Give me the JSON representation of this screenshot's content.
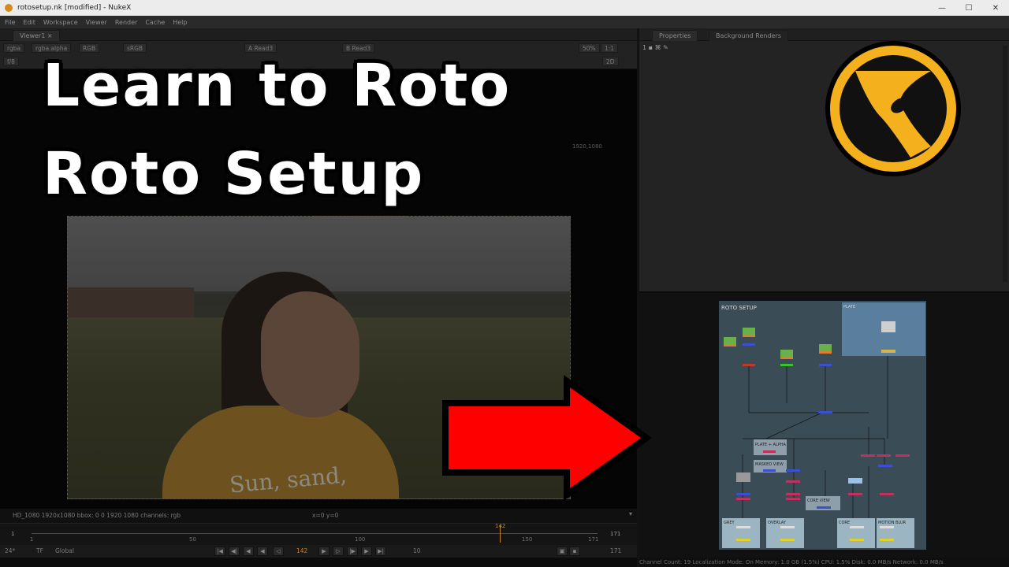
{
  "window": {
    "title": "rotosetup.nk [modified] - NukeX",
    "minimize": "—",
    "maximize": "☐",
    "close": "✕"
  },
  "menu": [
    "File",
    "Edit",
    "Workspace",
    "Viewer",
    "Render",
    "Cache",
    "Help"
  ],
  "viewer": {
    "tab": "Viewer1",
    "toolbar": {
      "channels": "rgba",
      "alpha_channel": "rgba.alpha",
      "colorspace_rgb": "RGB",
      "display": "sRGB",
      "input_a": "A  Read3",
      "input_b": "B  Read3",
      "zoom": "50%",
      "ratio": "1:1",
      "mode": "2D",
      "fstop": "f/8"
    },
    "format_label": "1920,1080",
    "info": {
      "format": "HD_1080 1920x1080  bbox: 0 0 1920 1080 channels: rgb",
      "coords": "x=0 y=0"
    },
    "image_text": "Sun, sand,"
  },
  "timeline": {
    "start": "1",
    "end": "171",
    "current_frame": "142",
    "ticks": [
      "1",
      "50",
      "100",
      "150",
      "171"
    ],
    "fps": "24*",
    "tf": "TF",
    "scope": "Global",
    "step": "10",
    "end_frame": "171"
  },
  "properties": {
    "tab_properties": "Properties",
    "tab_renders": "Background Renders",
    "count": "1"
  },
  "overlay": {
    "line1": "Learn to Roto",
    "line2": "Roto Setup"
  },
  "node_graph": {
    "backdrop_main": "ROTO SETUP",
    "backdrop_plate": "PLATE",
    "plate_alpha": "PLATE + ALPHA",
    "masked_view": "MASKED VIEW",
    "core_view": "CORE VIEW",
    "grey": "GREY",
    "overlay": "OVERLAY",
    "core": "CORE",
    "motion_blur": "MOTION BLUR"
  },
  "status_bar": "Channel Count: 19  Localization Mode: On  Memory: 1.0 GB (1.5%)  CPU: 1.5%  Disk: 0.0 MB/s  Network: 0.0 MB/s",
  "colors": {
    "nuke_logo_yellow": "#f5b01e",
    "arrow_red": "#ff0000",
    "accent_orange": "#c58422"
  }
}
